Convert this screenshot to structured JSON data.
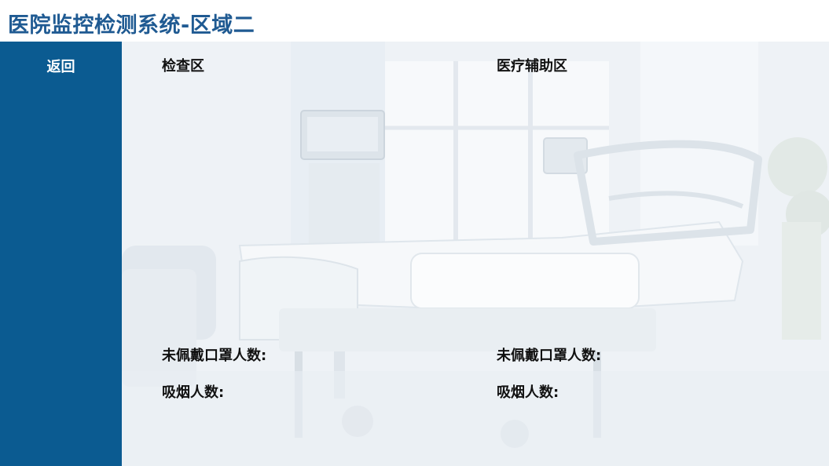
{
  "header": {
    "title": "医院监控检测系统-区域二"
  },
  "sidebar": {
    "back_label": "返回"
  },
  "zones": [
    {
      "name": "检查区",
      "no_mask_label": "未佩戴口罩人数:",
      "smoking_label": "吸烟人数:"
    },
    {
      "name": "医疗辅助区",
      "no_mask_label": "未佩戴口罩人数:",
      "smoking_label": "吸烟人数:"
    }
  ]
}
